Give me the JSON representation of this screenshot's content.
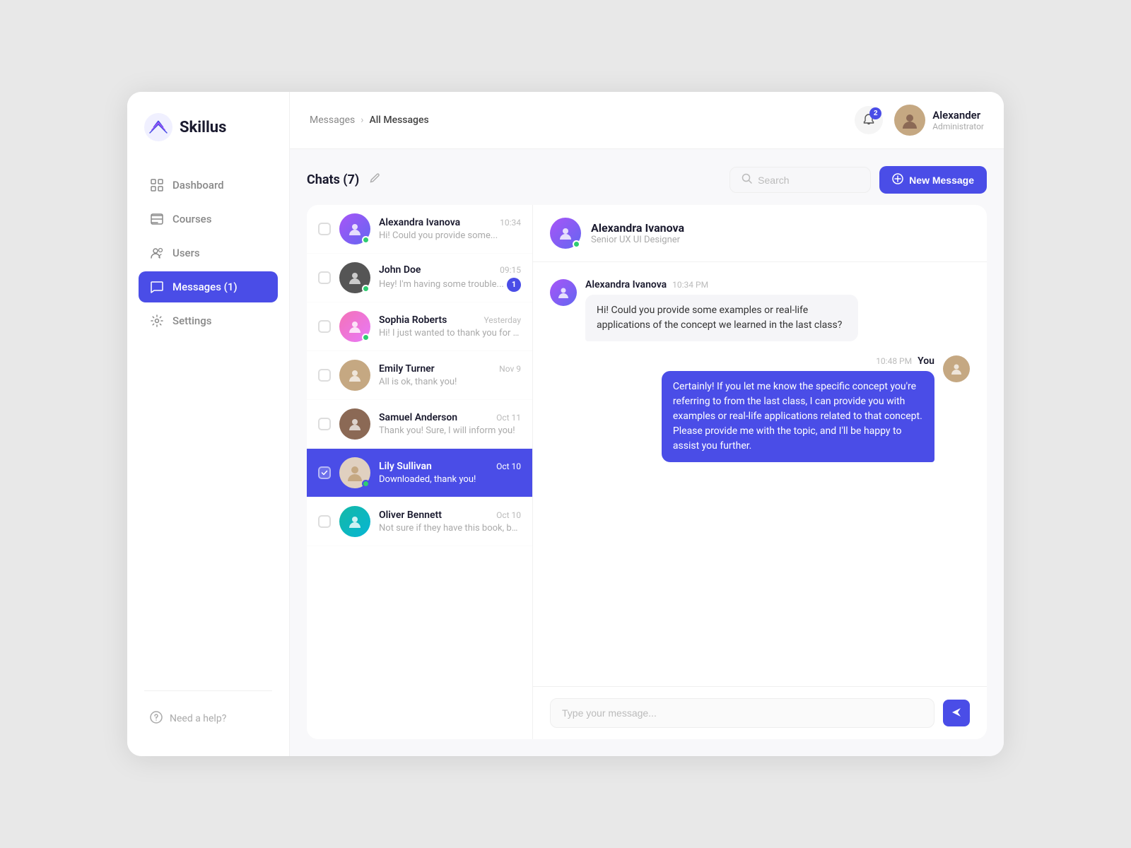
{
  "app": {
    "name": "Skillus"
  },
  "breadcrumb": {
    "parent": "Messages",
    "current": "All Messages"
  },
  "topbar_user": {
    "name": "Alexander",
    "role": "Administrator",
    "notifications": 2
  },
  "sidebar": {
    "nav_items": [
      {
        "id": "dashboard",
        "label": "Dashboard",
        "active": false
      },
      {
        "id": "courses",
        "label": "Courses",
        "active": false
      },
      {
        "id": "users",
        "label": "Users",
        "active": false
      },
      {
        "id": "messages",
        "label": "Messages (1)",
        "active": true
      },
      {
        "id": "settings",
        "label": "Settings",
        "active": false
      }
    ],
    "help_label": "Need a help?"
  },
  "chats": {
    "title": "Chats",
    "count": 7,
    "search_placeholder": "Search",
    "new_message_label": "New Message",
    "items": [
      {
        "id": 1,
        "name": "Alexandra Ivanova",
        "preview": "Hi! Could you provide some...",
        "time": "10:34",
        "unread": 0,
        "online": true,
        "active": false,
        "avatar_color": "av-purple"
      },
      {
        "id": 2,
        "name": "John Doe",
        "preview": "Hey! I'm having some trouble...",
        "time": "09:15",
        "unread": 1,
        "online": true,
        "active": false,
        "avatar_color": "av-dark"
      },
      {
        "id": 3,
        "name": "Sophia Roberts",
        "preview": "Hi! I just wanted to thank you for th...",
        "time": "Yesterday",
        "unread": 0,
        "online": true,
        "active": false,
        "avatar_color": "av-pink"
      },
      {
        "id": 4,
        "name": "Emily Turner",
        "preview": "All is ok, thank you!",
        "time": "Nov 9",
        "unread": 0,
        "online": false,
        "active": false,
        "avatar_color": "av-beige"
      },
      {
        "id": 5,
        "name": "Samuel Anderson",
        "preview": "Thank you! Sure, I will inform you!",
        "time": "Oct 11",
        "unread": 0,
        "online": false,
        "active": false,
        "avatar_color": "av-brown"
      },
      {
        "id": 6,
        "name": "Lily Sullivan",
        "preview": "Downloaded, thank you!",
        "time": "Oct 10",
        "unread": 0,
        "online": true,
        "active": true,
        "avatar_color": "av-white"
      },
      {
        "id": 7,
        "name": "Oliver Bennett",
        "preview": "Not sure if they have this book, but I...",
        "time": "Oct 10",
        "unread": 0,
        "online": false,
        "active": false,
        "avatar_color": "av-teal"
      }
    ]
  },
  "chat_detail": {
    "contact_name": "Alexandra Ivanova",
    "contact_role": "Senior UX UI Designer",
    "messages": [
      {
        "id": 1,
        "sender": "Alexandra Ivanova",
        "time": "10:34 PM",
        "text": "Hi! Could you provide some examples or real-life applications of the concept we learned in the last class?",
        "outgoing": false
      },
      {
        "id": 2,
        "sender": "You",
        "time": "10:48 PM",
        "text": "Certainly! If you let me know the specific concept you're referring to from the last class, I can provide you with examples or real-life applications related to that concept. Please provide me with the topic, and I'll be happy to assist you further.",
        "outgoing": true
      }
    ],
    "input_placeholder": "Type your message..."
  }
}
